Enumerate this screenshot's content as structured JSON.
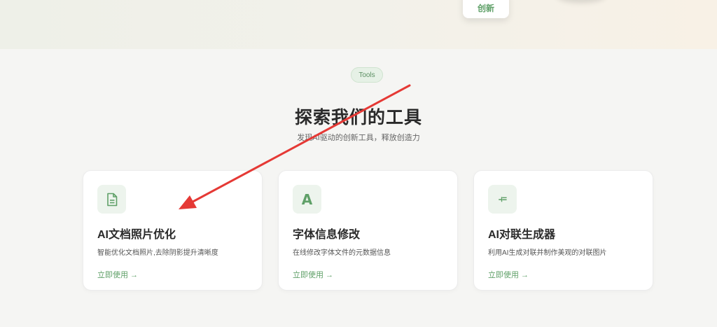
{
  "hero": {
    "card_label": "创新"
  },
  "tools_section": {
    "badge": "Tools",
    "title": "探索我们的工具",
    "subtitle": "发现AI驱动的创新工具，释放创造力"
  },
  "cards": [
    {
      "icon": "document-icon",
      "title": "AI文档照片优化",
      "description": "智能优化文档照片,去除阴影提升清晰度",
      "link": "立即使用 →"
    },
    {
      "icon": "font-letter-icon",
      "icon_text": "A",
      "title": "字体信息修改",
      "description": "在线修改字体文件的元数据信息",
      "link": "立即使用 →"
    },
    {
      "icon": "couplet-icon",
      "icon_text": "⫞=",
      "title": "AI对联生成器",
      "description": "利用AI生成对联并制作美观的对联图片",
      "link": "立即使用 →"
    }
  ],
  "colors": {
    "accent": "#5fa068",
    "annotation_arrow": "#e53935"
  }
}
